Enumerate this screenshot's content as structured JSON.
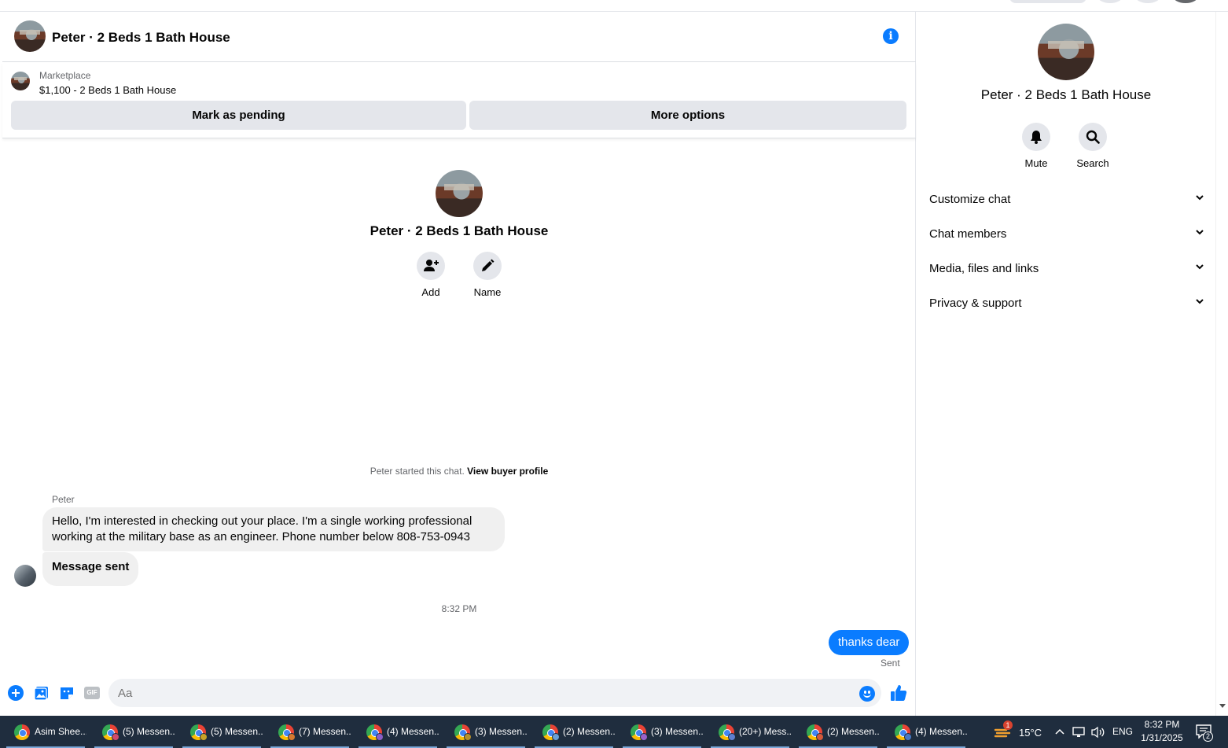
{
  "chat": {
    "title": "Peter · 2 Beds 1 Bath House",
    "info_icon": "info-icon",
    "marketplace": {
      "label": "Marketplace",
      "listing": "$1,100 - 2 Beds 1 Bath House",
      "pending_button": "Mark as pending",
      "more_button": "More options"
    },
    "intro": {
      "title": "Peter · 2 Beds 1 Bath House",
      "add_label": "Add",
      "name_label": "Name"
    },
    "started_text": "Peter started this chat.",
    "view_profile": "View buyer profile",
    "messages": {
      "sender": "Peter",
      "incoming_1": "Hello, I'm interested in checking out your place. I'm a single working professional working at the military base as an engineer. Phone number below 808-753-0943",
      "incoming_2": "Message sent",
      "timestamp": "8:32 PM",
      "outgoing_1": "thanks dear",
      "status": "Sent"
    },
    "composer": {
      "placeholder": "Aa",
      "gif_label": "GIF"
    }
  },
  "sidebar": {
    "title": "Peter · 2 Beds 1 Bath House",
    "mute_label": "Mute",
    "search_label": "Search",
    "sections": [
      "Customize chat",
      "Chat members",
      "Media, files and links",
      "Privacy & support"
    ]
  },
  "taskbar": {
    "items": [
      {
        "label": "Asim Shee..."
      },
      {
        "label": "(5) Messen..."
      },
      {
        "label": "(5) Messen..."
      },
      {
        "label": "(7) Messen..."
      },
      {
        "label": "(4) Messen..."
      },
      {
        "label": "(3) Messen..."
      },
      {
        "label": "(2) Messen..."
      },
      {
        "label": "(3) Messen..."
      },
      {
        "label": "(20+) Mess..."
      },
      {
        "label": "(2) Messen..."
      },
      {
        "label": "(4) Messen..."
      }
    ],
    "weather_badge": "1",
    "temperature": "15°C",
    "language": "ENG",
    "time": "8:32 PM",
    "date": "1/31/2025",
    "notification_count": "2"
  },
  "colors": {
    "accent": "#0a7cff",
    "taskbar": "#1f2d3e",
    "button_bg": "#e4e6eb"
  }
}
